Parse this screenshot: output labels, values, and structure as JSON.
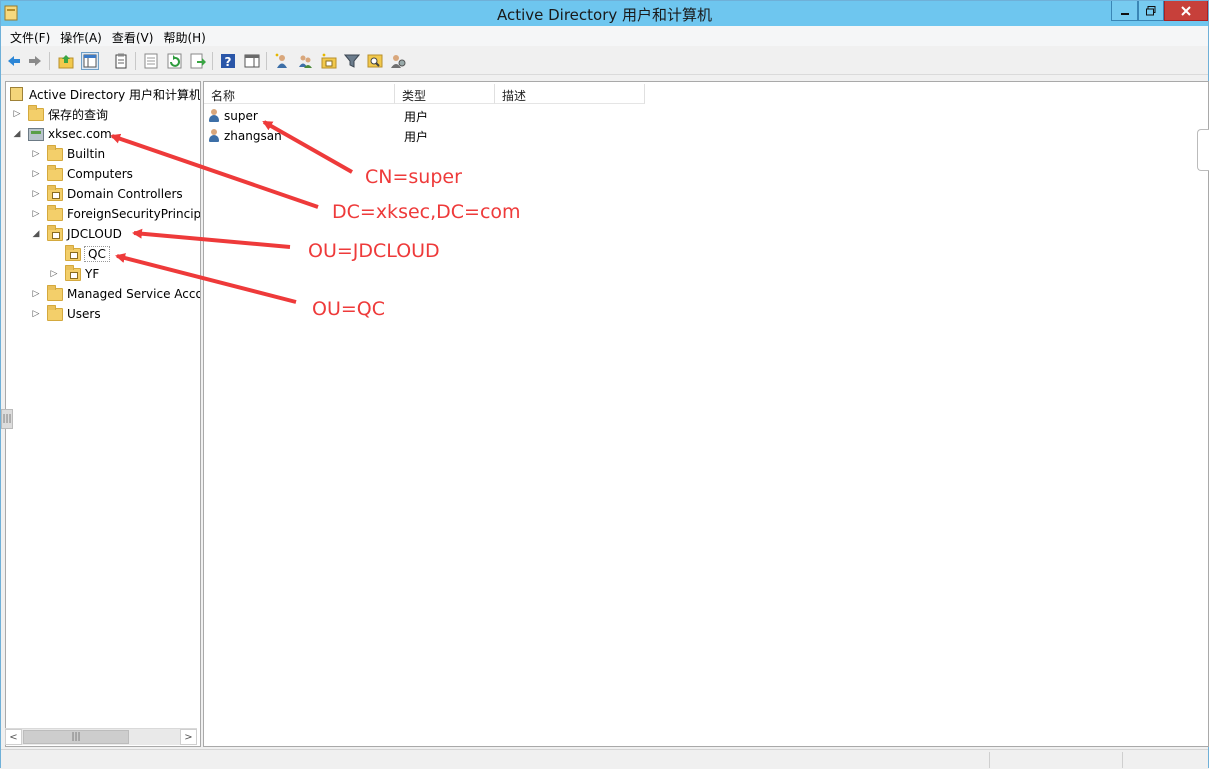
{
  "window": {
    "title": "Active Directory 用户和计算机"
  },
  "menu": [
    "文件(F)",
    "操作(A)",
    "查看(V)",
    "帮助(H)"
  ],
  "tree": {
    "root": "Active Directory 用户和计算机",
    "saved_queries": "保存的查询",
    "domain": "xksec.com",
    "children": [
      "Builtin",
      "Computers",
      "Domain Controllers",
      "ForeignSecurityPrincipals",
      "JDCLOUD"
    ],
    "jdcloud_children": [
      "QC",
      "YF"
    ],
    "after_jdcloud": [
      "Managed Service Accounts",
      "Users"
    ]
  },
  "list": {
    "columns": [
      "名称",
      "类型",
      "描述"
    ],
    "rows": [
      {
        "name": "super",
        "type": "用户"
      },
      {
        "name": "zhangsan",
        "type": "用户"
      }
    ]
  },
  "annotations": {
    "cn": "CN=super",
    "dc": "DC=xksec,DC=com",
    "ou_jd": "OU=JDCLOUD",
    "ou_qc": "OU=QC"
  },
  "colors": {
    "titlebar": "#6ec6ef",
    "annotation": "#ee3a3a",
    "close": "#c7403a"
  },
  "icons": {
    "toolbar": [
      "back-arrow-icon",
      "forward-arrow-icon",
      "up-folder-icon",
      "show-tree-icon",
      "clipboard-icon",
      "properties-icon",
      "refresh-icon",
      "export-icon",
      "help-icon",
      "show-actions-icon",
      "new-user-icon",
      "new-group-icon",
      "new-ou-icon",
      "filter-icon",
      "find-icon",
      "delegate-icon"
    ]
  }
}
